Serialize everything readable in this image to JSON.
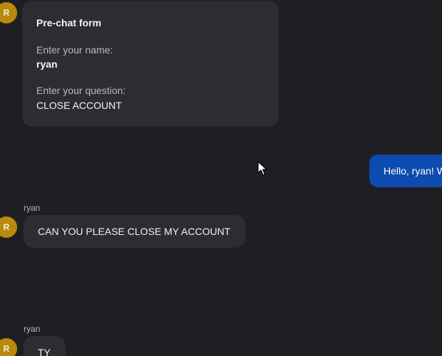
{
  "prechat_form": {
    "avatar_initial": "R",
    "title": "Pre-chat form",
    "name_label": "Enter your name:",
    "name_value": "ryan",
    "question_label": "Enter your question:",
    "question_value": "CLOSE ACCOUNT"
  },
  "messages": [
    {
      "direction": "outgoing",
      "text": "Hello, ryan! W"
    },
    {
      "direction": "incoming",
      "sender": "ryan",
      "avatar_initial": "R",
      "text": "CAN YOU PLEASE CLOSE MY ACCOUNT"
    },
    {
      "direction": "incoming",
      "sender": "ryan",
      "avatar_initial": "R",
      "text": "TY"
    }
  ],
  "colors": {
    "background": "#1f1e22",
    "incoming_bubble": "#2d2c31",
    "outgoing_bubble": "#0d4bb0",
    "avatar": "#b88a0f"
  },
  "icons": {
    "cursor": "mouse-pointer-icon"
  }
}
